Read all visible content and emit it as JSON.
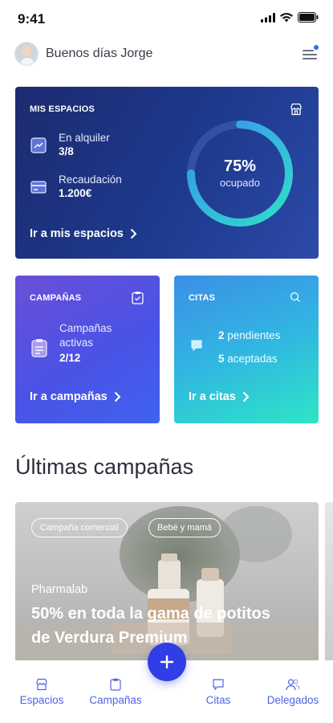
{
  "status_bar": {
    "time": "9:41",
    "icons": [
      "signal-icon",
      "wifi-icon",
      "battery-icon"
    ]
  },
  "header": {
    "greeting": "Buenos días Jorge",
    "menu_icon": "menu-icon",
    "notification_dot_color": "#2e6bff"
  },
  "spaces_card": {
    "title": "MIS ESPACIOS",
    "icon": "store-icon",
    "rental_label": "En alquiler",
    "rental_value": "3/8",
    "revenue_label": "Recaudación",
    "revenue_value": "1.200€",
    "occupancy_percent": 75,
    "occupancy_text": "75%",
    "occupancy_label": "ocupado",
    "link_label": "Ir a mis espacios"
  },
  "campaigns_card": {
    "title": "CAMPAÑAS",
    "icon": "clipboard-icon",
    "active_label": "Campañas activas",
    "active_value": "2/12",
    "link_label": "Ir a campañas"
  },
  "appointments_card": {
    "title": "CITAS",
    "icon": "chat-icon",
    "pending_count": "2",
    "pending_label": "pendientes",
    "accepted_count": "5",
    "accepted_label": "aceptadas",
    "link_label": "Ir a citas"
  },
  "latest_campaigns": {
    "title": "Últimas campañas",
    "cards": [
      {
        "tags": [
          "Campaña comercial",
          "Bebé y mamá"
        ],
        "brand": "Pharmalab",
        "headline": "50% en toda la gama de potitos de Verdura Premium"
      }
    ]
  },
  "tab_bar": {
    "items": [
      {
        "label": "Espacios",
        "icon": "store-icon"
      },
      {
        "label": "Campañas",
        "icon": "clipboard-icon"
      },
      {
        "label": "Citas",
        "icon": "chat-icon"
      },
      {
        "label": "Delegados",
        "icon": "users-icon"
      }
    ],
    "fab_icon": "plus-icon"
  },
  "colors": {
    "accent": "#2f3ee6",
    "tab_text": "#4f63e4",
    "spaces_bg": "#1d2a70",
    "donut_start": "#2fe0c6",
    "donut_end": "#3a8ef0"
  }
}
